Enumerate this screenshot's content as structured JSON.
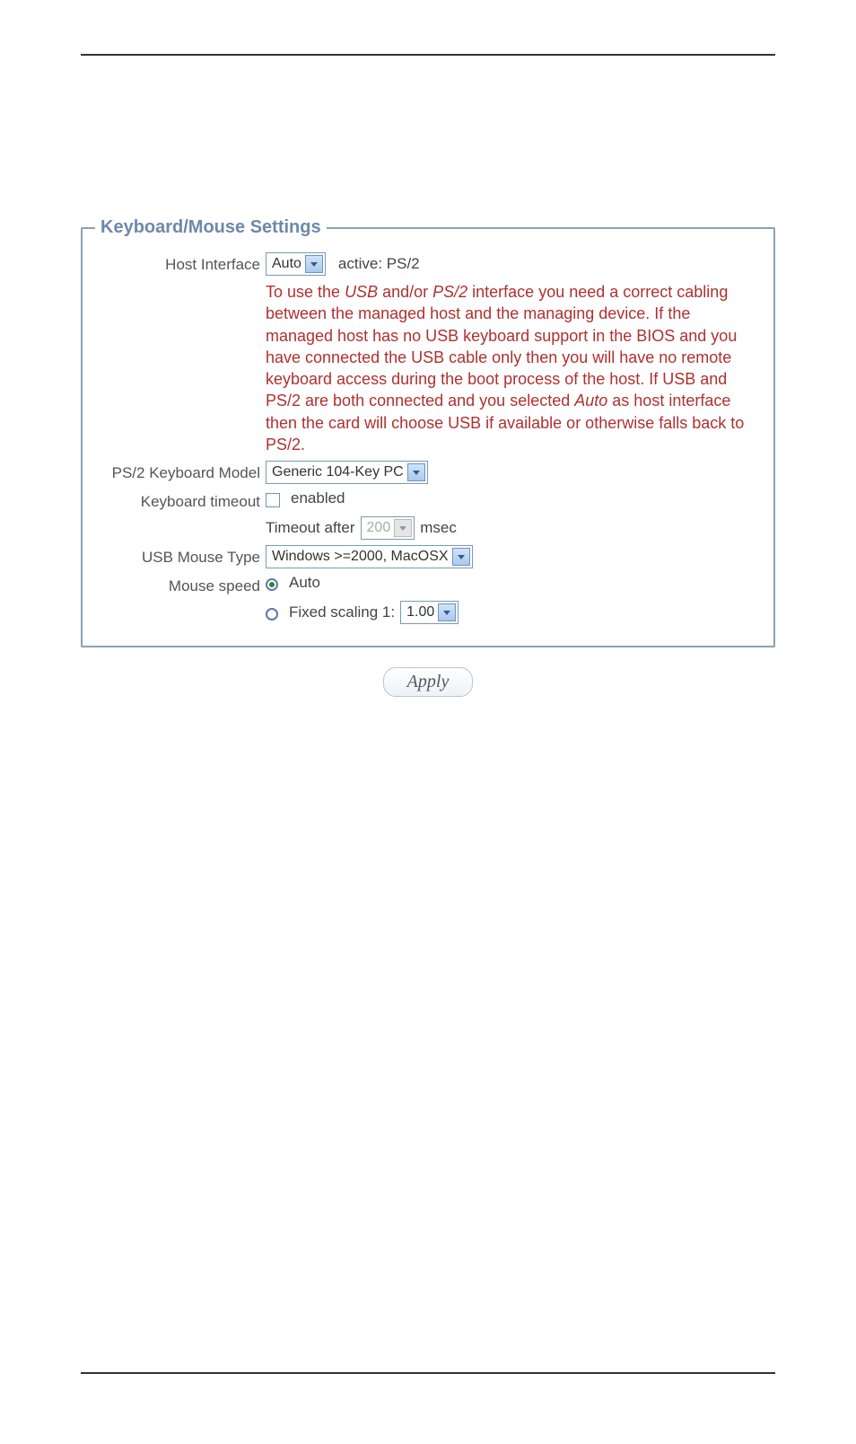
{
  "legend": "Keyboard/Mouse Settings",
  "host_interface": {
    "label": "Host Interface",
    "select_value": "Auto",
    "active_text": "active: PS/2"
  },
  "warning": {
    "p1a": "To use the ",
    "usb": "USB",
    "p1b": " and/or ",
    "ps2": "PS/2",
    "p1c": " interface you need a correct cabling between the managed host and the managing device. If the managed host has no USB keyboard support in the BIOS and you have connected the USB cable only then you will have no remote keyboard access during the boot process of the host. If USB and PS/2 are both connected and you selected ",
    "auto": "Auto",
    "p1d": " as host interface then the card will choose USB if available or otherwise falls back to PS/2."
  },
  "ps2_model": {
    "label": "PS/2 Keyboard Model",
    "select_value": "Generic 104-Key PC"
  },
  "kbd_timeout": {
    "label": "Keyboard timeout",
    "enabled_label": "enabled",
    "timeout_after_label": "Timeout after",
    "timeout_value": "200",
    "timeout_unit": "msec"
  },
  "usb_mouse": {
    "label": "USB Mouse Type",
    "select_value": "Windows >=2000, MacOSX"
  },
  "mouse_speed": {
    "label": "Mouse speed",
    "auto_label": "Auto",
    "fixed_label": "Fixed scaling 1:",
    "fixed_value": "1.00"
  },
  "apply_label": "Apply"
}
